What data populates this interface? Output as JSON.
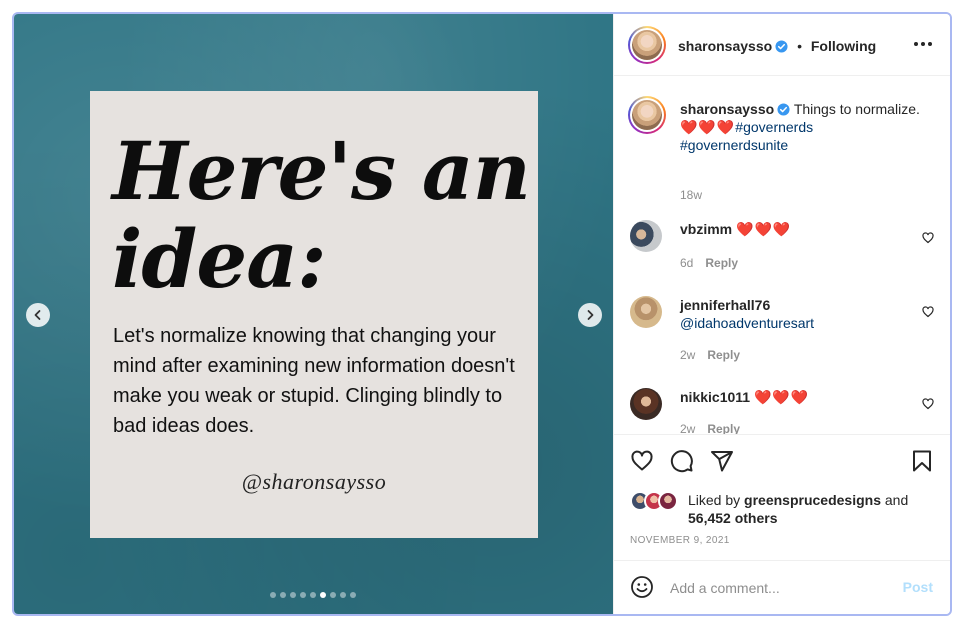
{
  "post": {
    "headline": "Here's an idea:",
    "body": "Let's normalize knowing that changing your mind after examining new information doesn't make you weak or stupid. Clinging blindly to bad ideas does.",
    "signature": "@sharonsaysso",
    "slide_count": 9,
    "active_slide_index": 5,
    "background_color": "#2f7585",
    "card_color": "#e6e2df"
  },
  "header": {
    "username": "sharonsaysso",
    "separator": "•",
    "follow_status": "Following",
    "verified_color": "#3897f0"
  },
  "caption": {
    "username": "sharonsaysso",
    "text": "Things to normalize.",
    "hearts": "❤️❤️❤️",
    "hashtag1": "#governerds",
    "hashtag2": "#governerdsunite",
    "time": "18w"
  },
  "comments": [
    {
      "username": "vbzimm",
      "text": "❤️❤️❤️",
      "time": "6d",
      "reply": "Reply"
    },
    {
      "username": "jenniferhall76",
      "text": "@idahoadventuresart",
      "time": "2w",
      "reply": "Reply"
    },
    {
      "username": "nikkic1011",
      "text": "❤️❤️❤️",
      "time": "2w",
      "reply": "Reply"
    }
  ],
  "likes": {
    "prefix": "Liked by",
    "user": "greensprucedesigns",
    "conjunction": "and",
    "others": "56,452 others"
  },
  "date": "NOVEMBER 9, 2021",
  "add_comment": {
    "placeholder": "Add a comment...",
    "post_label": "Post"
  },
  "colors": {
    "link": "#00376b",
    "muted": "#8e8e8e",
    "text": "#262626",
    "post_disabled": "#b2dffc"
  }
}
